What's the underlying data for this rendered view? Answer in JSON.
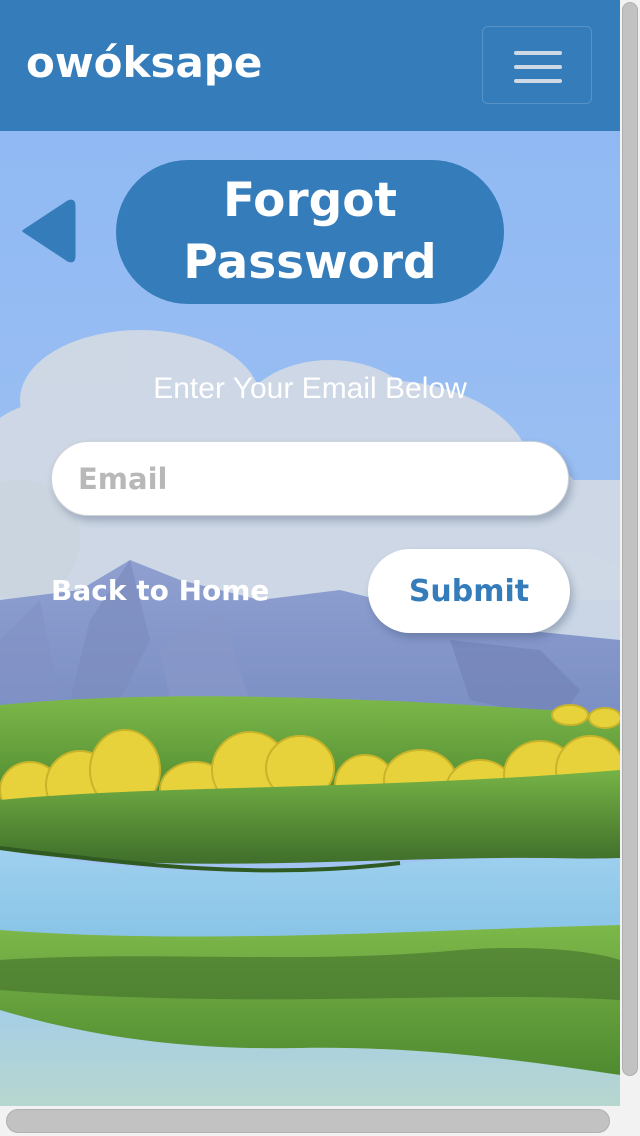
{
  "header": {
    "brand": "owóksape",
    "menu_icon": "hamburger-menu-icon"
  },
  "page": {
    "back_icon": "back-triangle-icon",
    "title": "Forgot Password",
    "prompt": "Enter Your Email Below"
  },
  "form": {
    "email": {
      "placeholder": "Email",
      "value": ""
    },
    "back_link_label": "Back to Home",
    "submit_label": "Submit"
  },
  "colors": {
    "brand_blue": "#357cba",
    "sky": "#93bdf6",
    "white": "#ffffff",
    "placeholder_gray": "#b8b8b8"
  }
}
